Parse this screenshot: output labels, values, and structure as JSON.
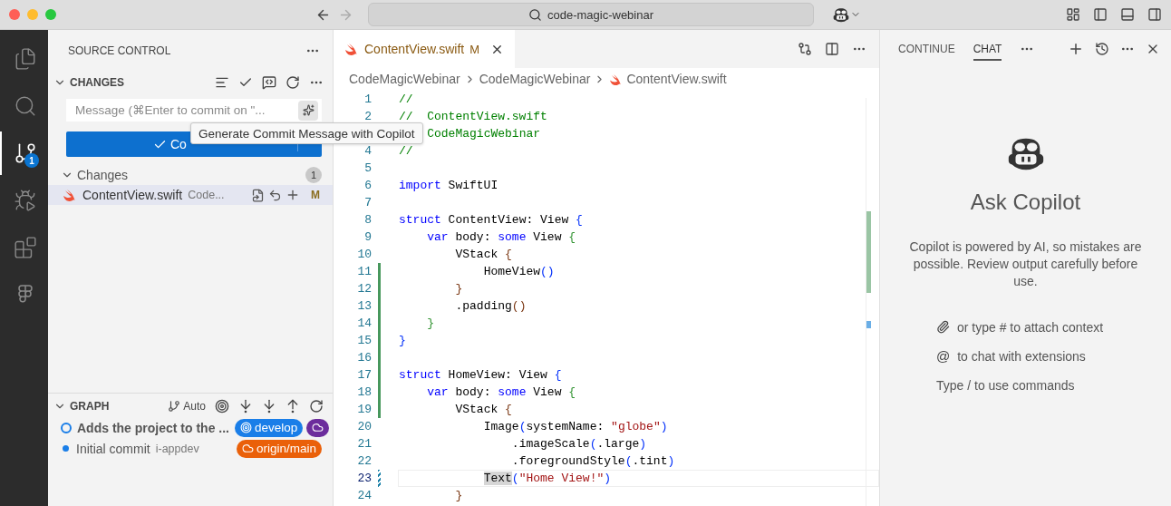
{
  "titlebar": {
    "search": "code-magic-webinar"
  },
  "activity_bar": [
    {
      "kind": "files",
      "selected": false
    },
    {
      "kind": "search",
      "selected": false
    },
    {
      "kind": "source-control",
      "selected": true,
      "badge": "1"
    },
    {
      "kind": "debug",
      "selected": false
    },
    {
      "kind": "extensions",
      "selected": false
    },
    {
      "kind": "figma",
      "selected": false
    }
  ],
  "sidebar": {
    "title": "SOURCE CONTROL",
    "changes": {
      "title": "CHANGES",
      "expanded": true,
      "placeholder": "Message (⌘Enter to commit on \"...",
      "commit_label": "Co",
      "tooltip": "Generate Commit Message with Copilot",
      "group": {
        "label": "Changes",
        "count": "1",
        "expanded": true
      },
      "files": [
        {
          "name": "ContentView.swift",
          "path": "Code...",
          "status": "M",
          "selected": true
        }
      ]
    },
    "graph": {
      "title": "GRAPH",
      "expanded": true,
      "mode": "Auto",
      "commits": [
        {
          "message": "Adds the project to the ...",
          "head": true,
          "refs": [
            {
              "kind": "branch",
              "label": "develop",
              "color": "#1a7ee8"
            },
            {
              "kind": "remote",
              "color": "#6c2d9c"
            }
          ]
        },
        {
          "message": "Initial commit",
          "author": "i-appdev",
          "head": false,
          "refs": [
            {
              "kind": "remote",
              "label": "origin/main",
              "color": "#ea6009"
            }
          ]
        }
      ]
    }
  },
  "editor": {
    "tab": {
      "name": "ContentView.swift",
      "status": "M",
      "selected": true
    },
    "breadcrumbs": [
      {
        "kind": "folder",
        "label": "CodeMagicWebinar"
      },
      {
        "kind": "folder",
        "label": "CodeMagicWebinar"
      },
      {
        "kind": "file",
        "label": "ContentView.swift"
      }
    ],
    "lines": [
      {
        "n": "1",
        "kind": "plain",
        "current": false,
        "tokens": [
          {
            "t": "//",
            "kind": "comment"
          }
        ]
      },
      {
        "n": "2",
        "kind": "plain",
        "current": false,
        "tokens": [
          {
            "t": "//  ContentView.swift",
            "kind": "comment"
          }
        ]
      },
      {
        "kind": "plain",
        "current": false,
        "tokens": [
          {
            "t": "    CodeMagicWebinar",
            "kind": "comment"
          }
        ]
      },
      {
        "n": "4",
        "kind": "plain",
        "current": false,
        "tokens": [
          {
            "t": "//",
            "kind": "comment"
          }
        ]
      },
      {
        "n": "5",
        "kind": "plain",
        "current": false
      },
      {
        "n": "6",
        "kind": "plain",
        "current": false,
        "tokens": [
          {
            "t": "import",
            "kind": "keyword"
          },
          {
            "t": " SwiftUI",
            "kind": "plain"
          }
        ]
      },
      {
        "n": "7",
        "kind": "plain",
        "current": false
      },
      {
        "n": "8",
        "kind": "plain",
        "current": false,
        "tokens": [
          {
            "t": "struct",
            "kind": "keyword"
          },
          {
            "t": " ContentView: View ",
            "kind": "plain"
          },
          {
            "t": "{",
            "kind": "bracket1"
          }
        ]
      },
      {
        "n": "9",
        "kind": "plain",
        "current": false,
        "tokens": [
          {
            "t": "    var",
            "kind": "keyword"
          },
          {
            "t": " body: ",
            "kind": "plain"
          },
          {
            "t": "some",
            "kind": "keyword"
          },
          {
            "t": " View ",
            "kind": "plain"
          },
          {
            "t": "{",
            "kind": "bracket2"
          }
        ]
      },
      {
        "n": "10",
        "kind": "plain",
        "current": false,
        "tokens": [
          {
            "t": "        VStack ",
            "kind": "plain"
          },
          {
            "t": "{",
            "kind": "bracket3"
          }
        ]
      },
      {
        "n": "11",
        "kind": "added",
        "current": false,
        "tokens": [
          {
            "t": "            HomeView",
            "kind": "plain"
          },
          {
            "t": "()",
            "kind": "bracket1"
          }
        ]
      },
      {
        "n": "12",
        "kind": "added",
        "current": false,
        "tokens": [
          {
            "t": "        }",
            "kind": "bracket3"
          }
        ]
      },
      {
        "n": "13",
        "kind": "added",
        "current": false,
        "tokens": [
          {
            "t": "        .padding",
            "kind": "plain"
          },
          {
            "t": "()",
            "kind": "bracket3"
          }
        ]
      },
      {
        "n": "14",
        "kind": "added",
        "current": false,
        "tokens": [
          {
            "t": "    }",
            "kind": "bracket2"
          }
        ]
      },
      {
        "n": "15",
        "kind": "added",
        "current": false,
        "tokens": [
          {
            "t": "}",
            "kind": "bracket1"
          }
        ]
      },
      {
        "n": "16",
        "kind": "added",
        "current": false
      },
      {
        "n": "17",
        "kind": "added",
        "current": false,
        "tokens": [
          {
            "t": "struct",
            "kind": "keyword"
          },
          {
            "t": " HomeView: View ",
            "kind": "plain"
          },
          {
            "t": "{",
            "kind": "bracket1"
          }
        ]
      },
      {
        "n": "18",
        "kind": "added",
        "current": false,
        "tokens": [
          {
            "t": "    var",
            "kind": "keyword"
          },
          {
            "t": " body: ",
            "kind": "plain"
          },
          {
            "t": "some",
            "kind": "keyword"
          },
          {
            "t": " View ",
            "kind": "plain"
          },
          {
            "t": "{",
            "kind": "bracket2"
          }
        ]
      },
      {
        "n": "19",
        "kind": "added",
        "current": false,
        "tokens": [
          {
            "t": "        VStack ",
            "kind": "plain"
          },
          {
            "t": "{",
            "kind": "bracket3"
          }
        ]
      },
      {
        "n": "20",
        "kind": "plain",
        "current": false,
        "tokens": [
          {
            "t": "            Image",
            "kind": "plain"
          },
          {
            "t": "(",
            "kind": "bracket1"
          },
          {
            "t": "systemName: ",
            "kind": "plain"
          },
          {
            "t": "\"globe\"",
            "kind": "string"
          },
          {
            "t": ")",
            "kind": "bracket1"
          }
        ]
      },
      {
        "n": "21",
        "kind": "plain",
        "current": false,
        "tokens": [
          {
            "t": "                .imageScale",
            "kind": "plain"
          },
          {
            "t": "(",
            "kind": "bracket1"
          },
          {
            "t": ".large",
            "kind": "plain"
          },
          {
            "t": ")",
            "kind": "bracket1"
          }
        ]
      },
      {
        "n": "22",
        "kind": "plain",
        "current": false,
        "tokens": [
          {
            "t": "                .foregroundStyle",
            "kind": "plain"
          },
          {
            "t": "(",
            "kind": "bracket1"
          },
          {
            "t": ".tint",
            "kind": "plain"
          },
          {
            "t": ")",
            "kind": "bracket1"
          }
        ]
      },
      {
        "n": "23",
        "kind": "modified",
        "current": true,
        "tokens": [
          {
            "t": "            Text",
            "kind": "match"
          },
          {
            "t": "(",
            "kind": "bracket1"
          },
          {
            "t": "\"Home View!\"",
            "kind": "string"
          },
          {
            "t": ")",
            "kind": "bracket1"
          }
        ]
      },
      {
        "n": "24",
        "kind": "plain",
        "current": false,
        "tokens": [
          {
            "t": "        }",
            "kind": "bracket3"
          }
        ]
      }
    ]
  },
  "chat": {
    "tabs": [
      {
        "label": "CONTINUE",
        "selected": false
      },
      {
        "label": "CHAT",
        "selected": true
      }
    ],
    "title": "Ask Copilot",
    "notice": "Copilot is powered by AI, so mistakes are possible. Review output carefully before use.",
    "hints": [
      {
        "kind": "attach",
        "text": "or type # to attach context"
      },
      {
        "kind": "mention",
        "symbol": "@",
        "text": "to chat with extensions"
      },
      {
        "kind": "plain",
        "text": "Type / to use commands"
      }
    ]
  }
}
